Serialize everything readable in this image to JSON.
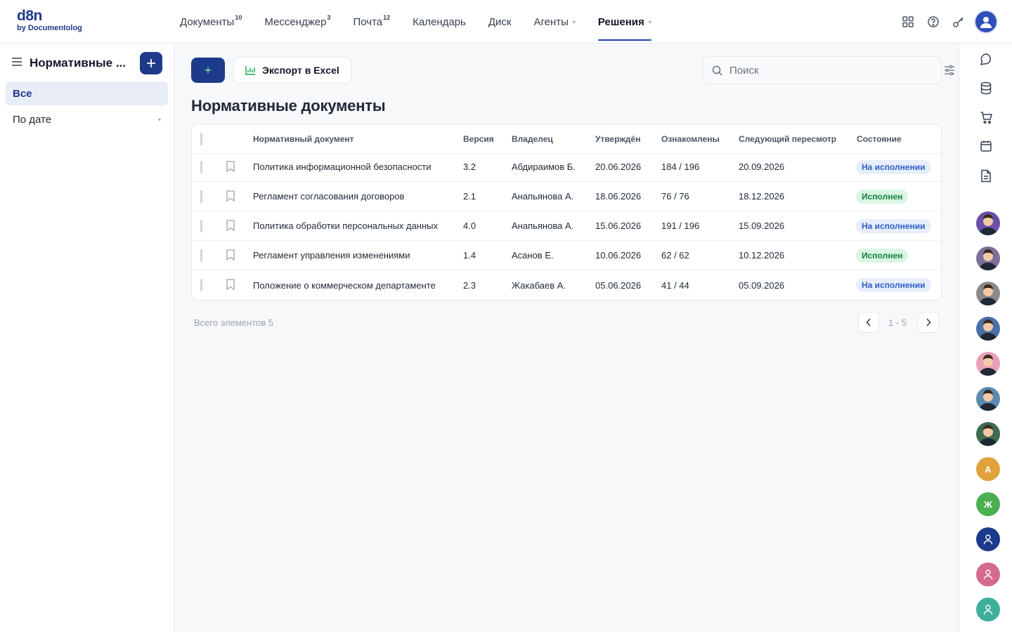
{
  "app": {
    "logo_main": "d8n",
    "logo_sub": "by Documentolog"
  },
  "nav": [
    {
      "label": "Документы",
      "badge": "10"
    },
    {
      "label": "Мессенджер",
      "badge": "3"
    },
    {
      "label": "Почта",
      "badge": "12"
    },
    {
      "label": "Календарь",
      "badge": ""
    },
    {
      "label": "Диск",
      "badge": ""
    },
    {
      "label": "Агенты",
      "badge": "",
      "caret": "▾"
    },
    {
      "label": "Решения",
      "badge": "",
      "caret": "▾",
      "active": true
    }
  ],
  "sidebar": {
    "title": "Нормативные ...",
    "items": [
      {
        "label": "Все",
        "active": true
      },
      {
        "label": "По дате",
        "caret": "▾"
      }
    ]
  },
  "toolbar": {
    "add_label": "+",
    "export_label": "Экспорт в Excel",
    "search_placeholder": "Поиск"
  },
  "page": {
    "title": "Нормативные документы"
  },
  "table": {
    "columns": [
      "Нормативный документ",
      "Версия",
      "Владелец",
      "Утверждён",
      "Ознакомлены",
      "Следующий пересмотр",
      "Состояние"
    ],
    "rows": [
      {
        "name": "Политика информационной безопасности",
        "version": "3.2",
        "owner": "Абдираимов Б.",
        "approved": "20.06.2026",
        "ack": "184 / 196",
        "next": "20.09.2026",
        "status": "На исполнении",
        "status_type": "progress"
      },
      {
        "name": "Регламент согласования договоров",
        "version": "2.1",
        "owner": "Анапьянова А.",
        "approved": "18.06.2026",
        "ack": "76 / 76",
        "next": "18.12.2026",
        "status": "Исполнен",
        "status_type": "done"
      },
      {
        "name": "Политика обработки персональных данных",
        "version": "4.0",
        "owner": "Анапьянова А.",
        "approved": "15.06.2026",
        "ack": "191 / 196",
        "next": "15.09.2026",
        "status": "На исполнении",
        "status_type": "progress"
      },
      {
        "name": "Регламент управления изменениями",
        "version": "1.4",
        "owner": "Асанов Е.",
        "approved": "10.06.2026",
        "ack": "62 / 62",
        "next": "10.12.2026",
        "status": "Исполнен",
        "status_type": "done"
      },
      {
        "name": "Положение о коммерческом департаменте",
        "version": "2.3",
        "owner": "Жакабаев А.",
        "approved": "05.06.2026",
        "ack": "41 / 44",
        "next": "05.09.2026",
        "status": "На исполнении",
        "status_type": "progress"
      }
    ]
  },
  "footer": {
    "total": "Всего элементов 5",
    "range": "1 - 5"
  },
  "rail": {
    "icons": [
      "chat-icon",
      "database-icon",
      "cart-icon",
      "calendar-icon",
      "document-icon"
    ],
    "avatars": [
      {
        "type": "photo",
        "color": "#6b4fa8"
      },
      {
        "type": "photo",
        "color": "#7b6f9a"
      },
      {
        "type": "photo",
        "color": "#8a8a8a"
      },
      {
        "type": "photo",
        "color": "#4a6fa5"
      },
      {
        "type": "photo",
        "color": "#e8a0b8"
      },
      {
        "type": "photo",
        "color": "#5b8bb0"
      },
      {
        "type": "photo",
        "color": "#3f6b4f"
      },
      {
        "type": "letter",
        "letter": "А",
        "color": "#e0a23a"
      },
      {
        "type": "letter",
        "letter": "Ж",
        "color": "#4caf50"
      },
      {
        "type": "user",
        "color": "#1e3a8a"
      },
      {
        "type": "user",
        "color": "#d46a8f"
      },
      {
        "type": "user",
        "color": "#3fae9a"
      }
    ]
  },
  "colors": {
    "primary": "#1e3a8a",
    "badge_progress": "#2f5ec4",
    "badge_done": "#15803d"
  }
}
